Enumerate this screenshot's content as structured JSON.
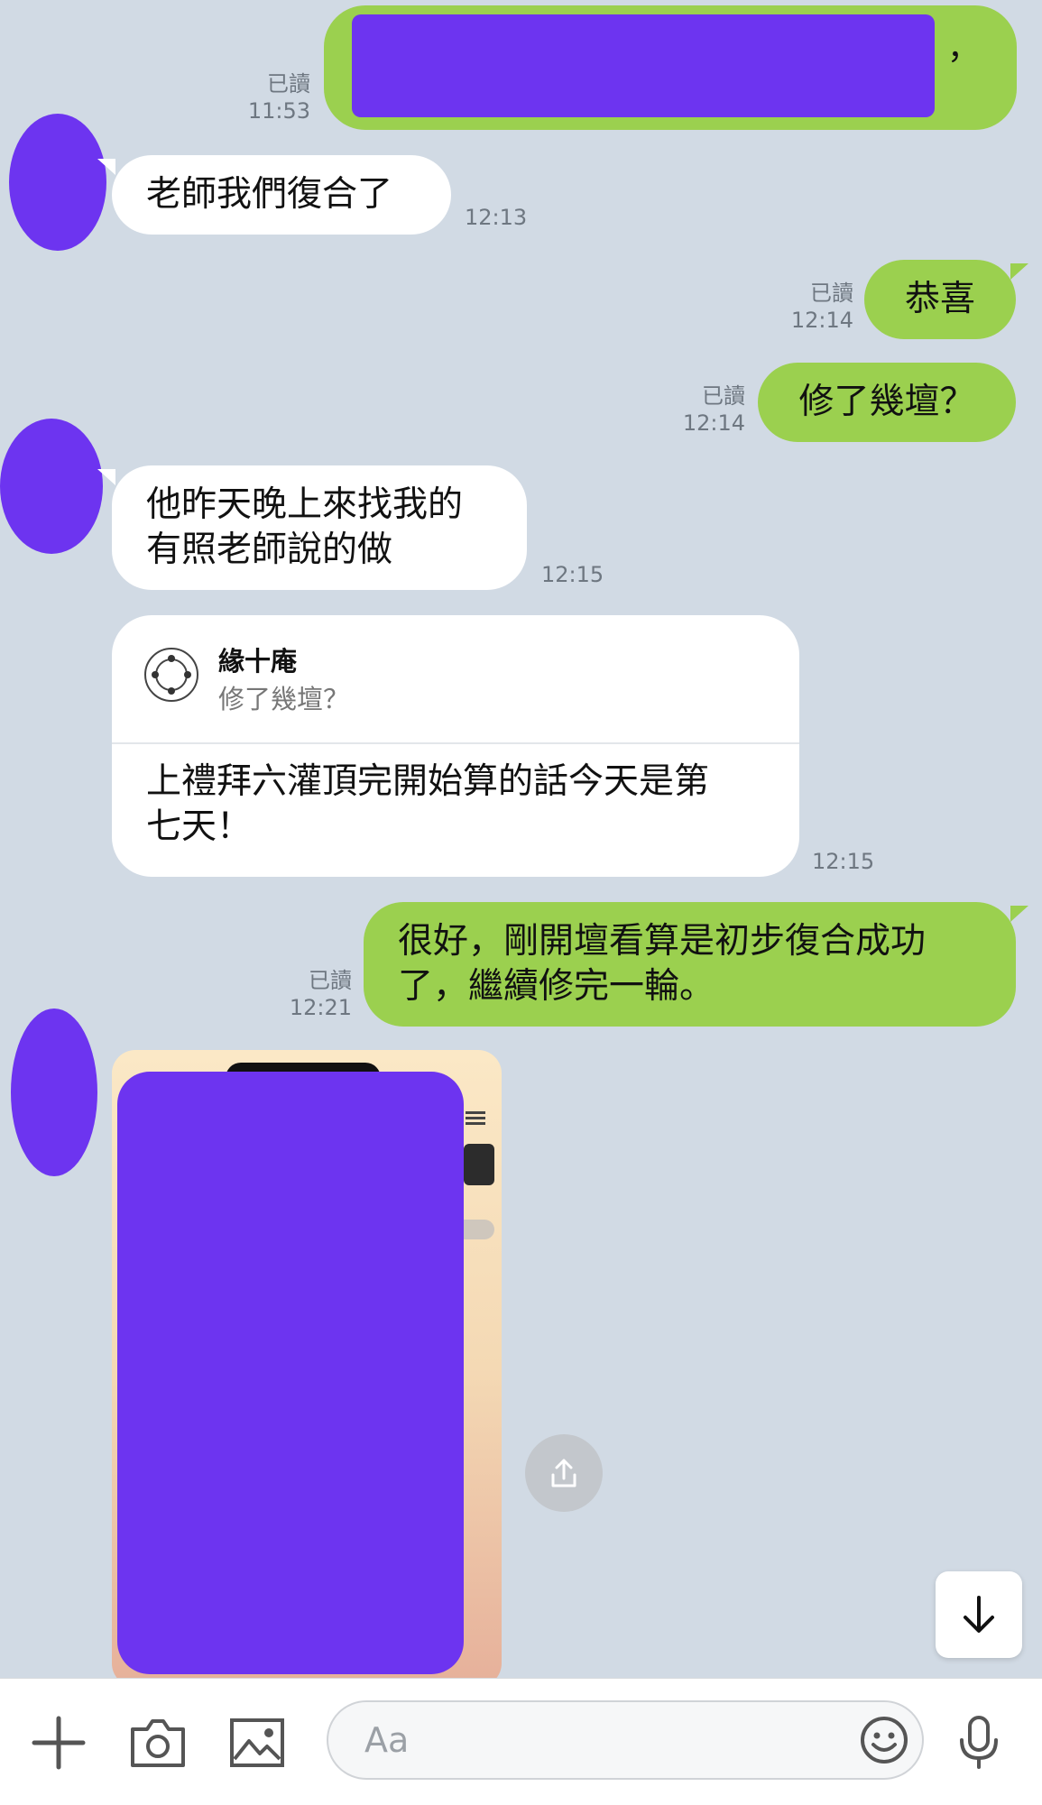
{
  "messages": {
    "m1_out": {
      "read": "已讀",
      "time": "11:53",
      "suffix": "，"
    },
    "m2_in": {
      "text": "老師我們復合了",
      "time": "12:13"
    },
    "m3_out": {
      "text": "恭喜",
      "read": "已讀",
      "time": "12:14"
    },
    "m4_out": {
      "text": "修了幾壇？",
      "read": "已讀",
      "time": "12:14"
    },
    "m5_in": {
      "line1": "他昨天晚上來找我的",
      "line2": "有照老師說的做",
      "time": "12:15"
    },
    "m6_in_reply": {
      "quote_name": "緣十庵",
      "quote_text": "修了幾壇？",
      "line1": "上禮拜六灌頂完開始算的話今天是第",
      "line2": "七天！",
      "time": "12:15"
    },
    "m7_out": {
      "line1": "很好，剛開壇看算是初步復合成功",
      "line2": "了，繼續修完一輪。",
      "read": "已讀",
      "time": "12:21"
    }
  },
  "composer": {
    "placeholder": "Aa",
    "icons": [
      "plus-icon",
      "camera-icon",
      "image-icon",
      "emoji-icon",
      "microphone-icon"
    ]
  },
  "colors": {
    "background": "#d1dae4",
    "outgoing_bubble": "#9bd04f",
    "incoming_bubble": "#ffffff",
    "redaction": "#6d34f0"
  }
}
